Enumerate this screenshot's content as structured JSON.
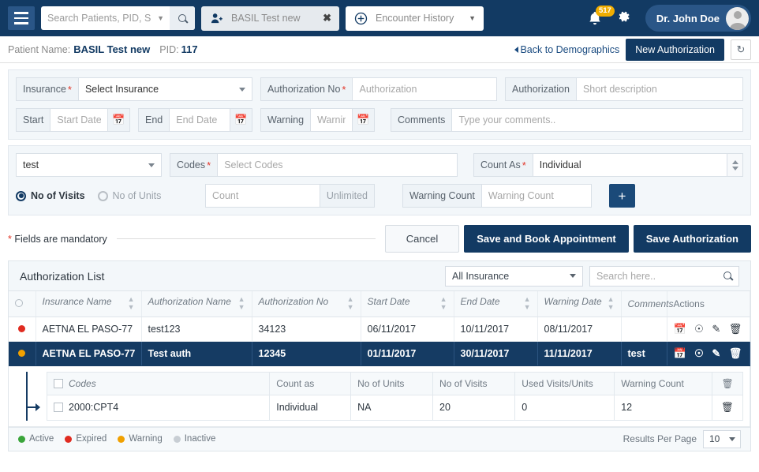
{
  "topnav": {
    "menu_icon": "hamburger-icon",
    "search": {
      "placeholder": "Search Patients, PID, SSN",
      "value": ""
    },
    "patient_tab": {
      "label": "BASIL Test new",
      "close": "✖"
    },
    "encounter_tab": {
      "label": "Encounter History"
    },
    "notification_badge": "517",
    "user": {
      "name": "Dr. John Doe"
    }
  },
  "patientbar": {
    "name_label": "Patient Name:",
    "name": "BASIL Test new",
    "pid_label": "PID:",
    "pid": "117",
    "back_link": "Back to Demographics",
    "new_auth_button": "New Authorization"
  },
  "form": {
    "insurance_label": "Insurance",
    "insurance_value": "Select Insurance",
    "auth_no_label": "Authorization No",
    "auth_no_placeholder": "Authorization",
    "auth_desc_label": "Authorization",
    "auth_desc_placeholder": "Short description",
    "start_label": "Start",
    "start_placeholder": "Start Date",
    "end_label": "End",
    "end_placeholder": "End Date",
    "warning_label": "Warning",
    "warning_placeholder": "Warning Date",
    "comments_label": "Comments",
    "comments_placeholder": "Type your comments..",
    "auth_type_value": "test",
    "codes_label": "Codes",
    "codes_placeholder": "Select Codes",
    "count_as_label": "Count As",
    "count_as_value": "Individual",
    "radio_visits": "No of Visits",
    "radio_units": "No of Units",
    "count_placeholder": "Count",
    "unlimited_label": "Unlimited",
    "warning_count_label": "Warning Count",
    "warning_count_placeholder": "Warning Count",
    "add_button": "+"
  },
  "actions": {
    "mandatory_note": "Fields are mandatory",
    "cancel": "Cancel",
    "save_and_book": "Save and Book Appointment",
    "save_auth": "Save Authorization"
  },
  "list": {
    "title": "Authorization List",
    "insurance_filter": "All Insurance",
    "search_placeholder": "Search here..",
    "columns": [
      "Insurance Name",
      "Authorization Name",
      "Authorization No",
      "Start Date",
      "End Date",
      "Warning Date",
      "Comments",
      "Actions"
    ],
    "rows": [
      {
        "status": "expired",
        "insurance_name": "AETNA EL PASO-77",
        "authorization_name": "test123",
        "authorization_no": "34123",
        "start_date": "06/11/2017",
        "end_date": "10/11/2017",
        "warning_date": "08/11/2017",
        "comments": "",
        "selected": false
      },
      {
        "status": "warning",
        "insurance_name": "AETNA EL PASO-77",
        "authorization_name": "Test auth",
        "authorization_no": "12345",
        "start_date": "01/11/2017",
        "end_date": "30/11/2017",
        "warning_date": "11/11/2017",
        "comments": "test",
        "selected": true
      }
    ],
    "subtable": {
      "columns": [
        "Codes",
        "Count as",
        "No of Units",
        "No of Visits",
        "Used Visits/Units",
        "Warning Count"
      ],
      "rows": [
        {
          "codes": "2000:CPT4",
          "count_as": "Individual",
          "no_of_units": "NA",
          "no_of_visits": "20",
          "used_visits_units": "0",
          "warning_count": "12"
        }
      ]
    },
    "legend": [
      {
        "label": "Active",
        "color": "#3aa53a"
      },
      {
        "label": "Expired",
        "color": "#e02b20"
      },
      {
        "label": "Warning",
        "color": "#f0a000"
      },
      {
        "label": "Inactive",
        "color": "#c8ced4"
      }
    ],
    "results_per_page_label": "Results Per Page",
    "results_per_page_value": "10"
  }
}
